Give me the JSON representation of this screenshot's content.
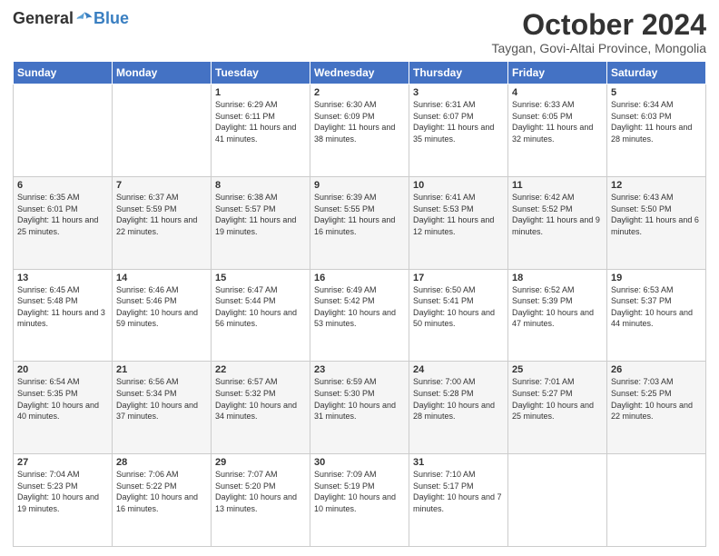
{
  "logo": {
    "general": "General",
    "blue": "Blue"
  },
  "header": {
    "month": "October 2024",
    "location": "Taygan, Govi-Altai Province, Mongolia"
  },
  "weekdays": [
    "Sunday",
    "Monday",
    "Tuesday",
    "Wednesday",
    "Thursday",
    "Friday",
    "Saturday"
  ],
  "weeks": [
    [
      {
        "day": "",
        "info": ""
      },
      {
        "day": "",
        "info": ""
      },
      {
        "day": "1",
        "info": "Sunrise: 6:29 AM\nSunset: 6:11 PM\nDaylight: 11 hours and 41 minutes."
      },
      {
        "day": "2",
        "info": "Sunrise: 6:30 AM\nSunset: 6:09 PM\nDaylight: 11 hours and 38 minutes."
      },
      {
        "day": "3",
        "info": "Sunrise: 6:31 AM\nSunset: 6:07 PM\nDaylight: 11 hours and 35 minutes."
      },
      {
        "day": "4",
        "info": "Sunrise: 6:33 AM\nSunset: 6:05 PM\nDaylight: 11 hours and 32 minutes."
      },
      {
        "day": "5",
        "info": "Sunrise: 6:34 AM\nSunset: 6:03 PM\nDaylight: 11 hours and 28 minutes."
      }
    ],
    [
      {
        "day": "6",
        "info": "Sunrise: 6:35 AM\nSunset: 6:01 PM\nDaylight: 11 hours and 25 minutes."
      },
      {
        "day": "7",
        "info": "Sunrise: 6:37 AM\nSunset: 5:59 PM\nDaylight: 11 hours and 22 minutes."
      },
      {
        "day": "8",
        "info": "Sunrise: 6:38 AM\nSunset: 5:57 PM\nDaylight: 11 hours and 19 minutes."
      },
      {
        "day": "9",
        "info": "Sunrise: 6:39 AM\nSunset: 5:55 PM\nDaylight: 11 hours and 16 minutes."
      },
      {
        "day": "10",
        "info": "Sunrise: 6:41 AM\nSunset: 5:53 PM\nDaylight: 11 hours and 12 minutes."
      },
      {
        "day": "11",
        "info": "Sunrise: 6:42 AM\nSunset: 5:52 PM\nDaylight: 11 hours and 9 minutes."
      },
      {
        "day": "12",
        "info": "Sunrise: 6:43 AM\nSunset: 5:50 PM\nDaylight: 11 hours and 6 minutes."
      }
    ],
    [
      {
        "day": "13",
        "info": "Sunrise: 6:45 AM\nSunset: 5:48 PM\nDaylight: 11 hours and 3 minutes."
      },
      {
        "day": "14",
        "info": "Sunrise: 6:46 AM\nSunset: 5:46 PM\nDaylight: 10 hours and 59 minutes."
      },
      {
        "day": "15",
        "info": "Sunrise: 6:47 AM\nSunset: 5:44 PM\nDaylight: 10 hours and 56 minutes."
      },
      {
        "day": "16",
        "info": "Sunrise: 6:49 AM\nSunset: 5:42 PM\nDaylight: 10 hours and 53 minutes."
      },
      {
        "day": "17",
        "info": "Sunrise: 6:50 AM\nSunset: 5:41 PM\nDaylight: 10 hours and 50 minutes."
      },
      {
        "day": "18",
        "info": "Sunrise: 6:52 AM\nSunset: 5:39 PM\nDaylight: 10 hours and 47 minutes."
      },
      {
        "day": "19",
        "info": "Sunrise: 6:53 AM\nSunset: 5:37 PM\nDaylight: 10 hours and 44 minutes."
      }
    ],
    [
      {
        "day": "20",
        "info": "Sunrise: 6:54 AM\nSunset: 5:35 PM\nDaylight: 10 hours and 40 minutes."
      },
      {
        "day": "21",
        "info": "Sunrise: 6:56 AM\nSunset: 5:34 PM\nDaylight: 10 hours and 37 minutes."
      },
      {
        "day": "22",
        "info": "Sunrise: 6:57 AM\nSunset: 5:32 PM\nDaylight: 10 hours and 34 minutes."
      },
      {
        "day": "23",
        "info": "Sunrise: 6:59 AM\nSunset: 5:30 PM\nDaylight: 10 hours and 31 minutes."
      },
      {
        "day": "24",
        "info": "Sunrise: 7:00 AM\nSunset: 5:28 PM\nDaylight: 10 hours and 28 minutes."
      },
      {
        "day": "25",
        "info": "Sunrise: 7:01 AM\nSunset: 5:27 PM\nDaylight: 10 hours and 25 minutes."
      },
      {
        "day": "26",
        "info": "Sunrise: 7:03 AM\nSunset: 5:25 PM\nDaylight: 10 hours and 22 minutes."
      }
    ],
    [
      {
        "day": "27",
        "info": "Sunrise: 7:04 AM\nSunset: 5:23 PM\nDaylight: 10 hours and 19 minutes."
      },
      {
        "day": "28",
        "info": "Sunrise: 7:06 AM\nSunset: 5:22 PM\nDaylight: 10 hours and 16 minutes."
      },
      {
        "day": "29",
        "info": "Sunrise: 7:07 AM\nSunset: 5:20 PM\nDaylight: 10 hours and 13 minutes."
      },
      {
        "day": "30",
        "info": "Sunrise: 7:09 AM\nSunset: 5:19 PM\nDaylight: 10 hours and 10 minutes."
      },
      {
        "day": "31",
        "info": "Sunrise: 7:10 AM\nSunset: 5:17 PM\nDaylight: 10 hours and 7 minutes."
      },
      {
        "day": "",
        "info": ""
      },
      {
        "day": "",
        "info": ""
      }
    ]
  ]
}
